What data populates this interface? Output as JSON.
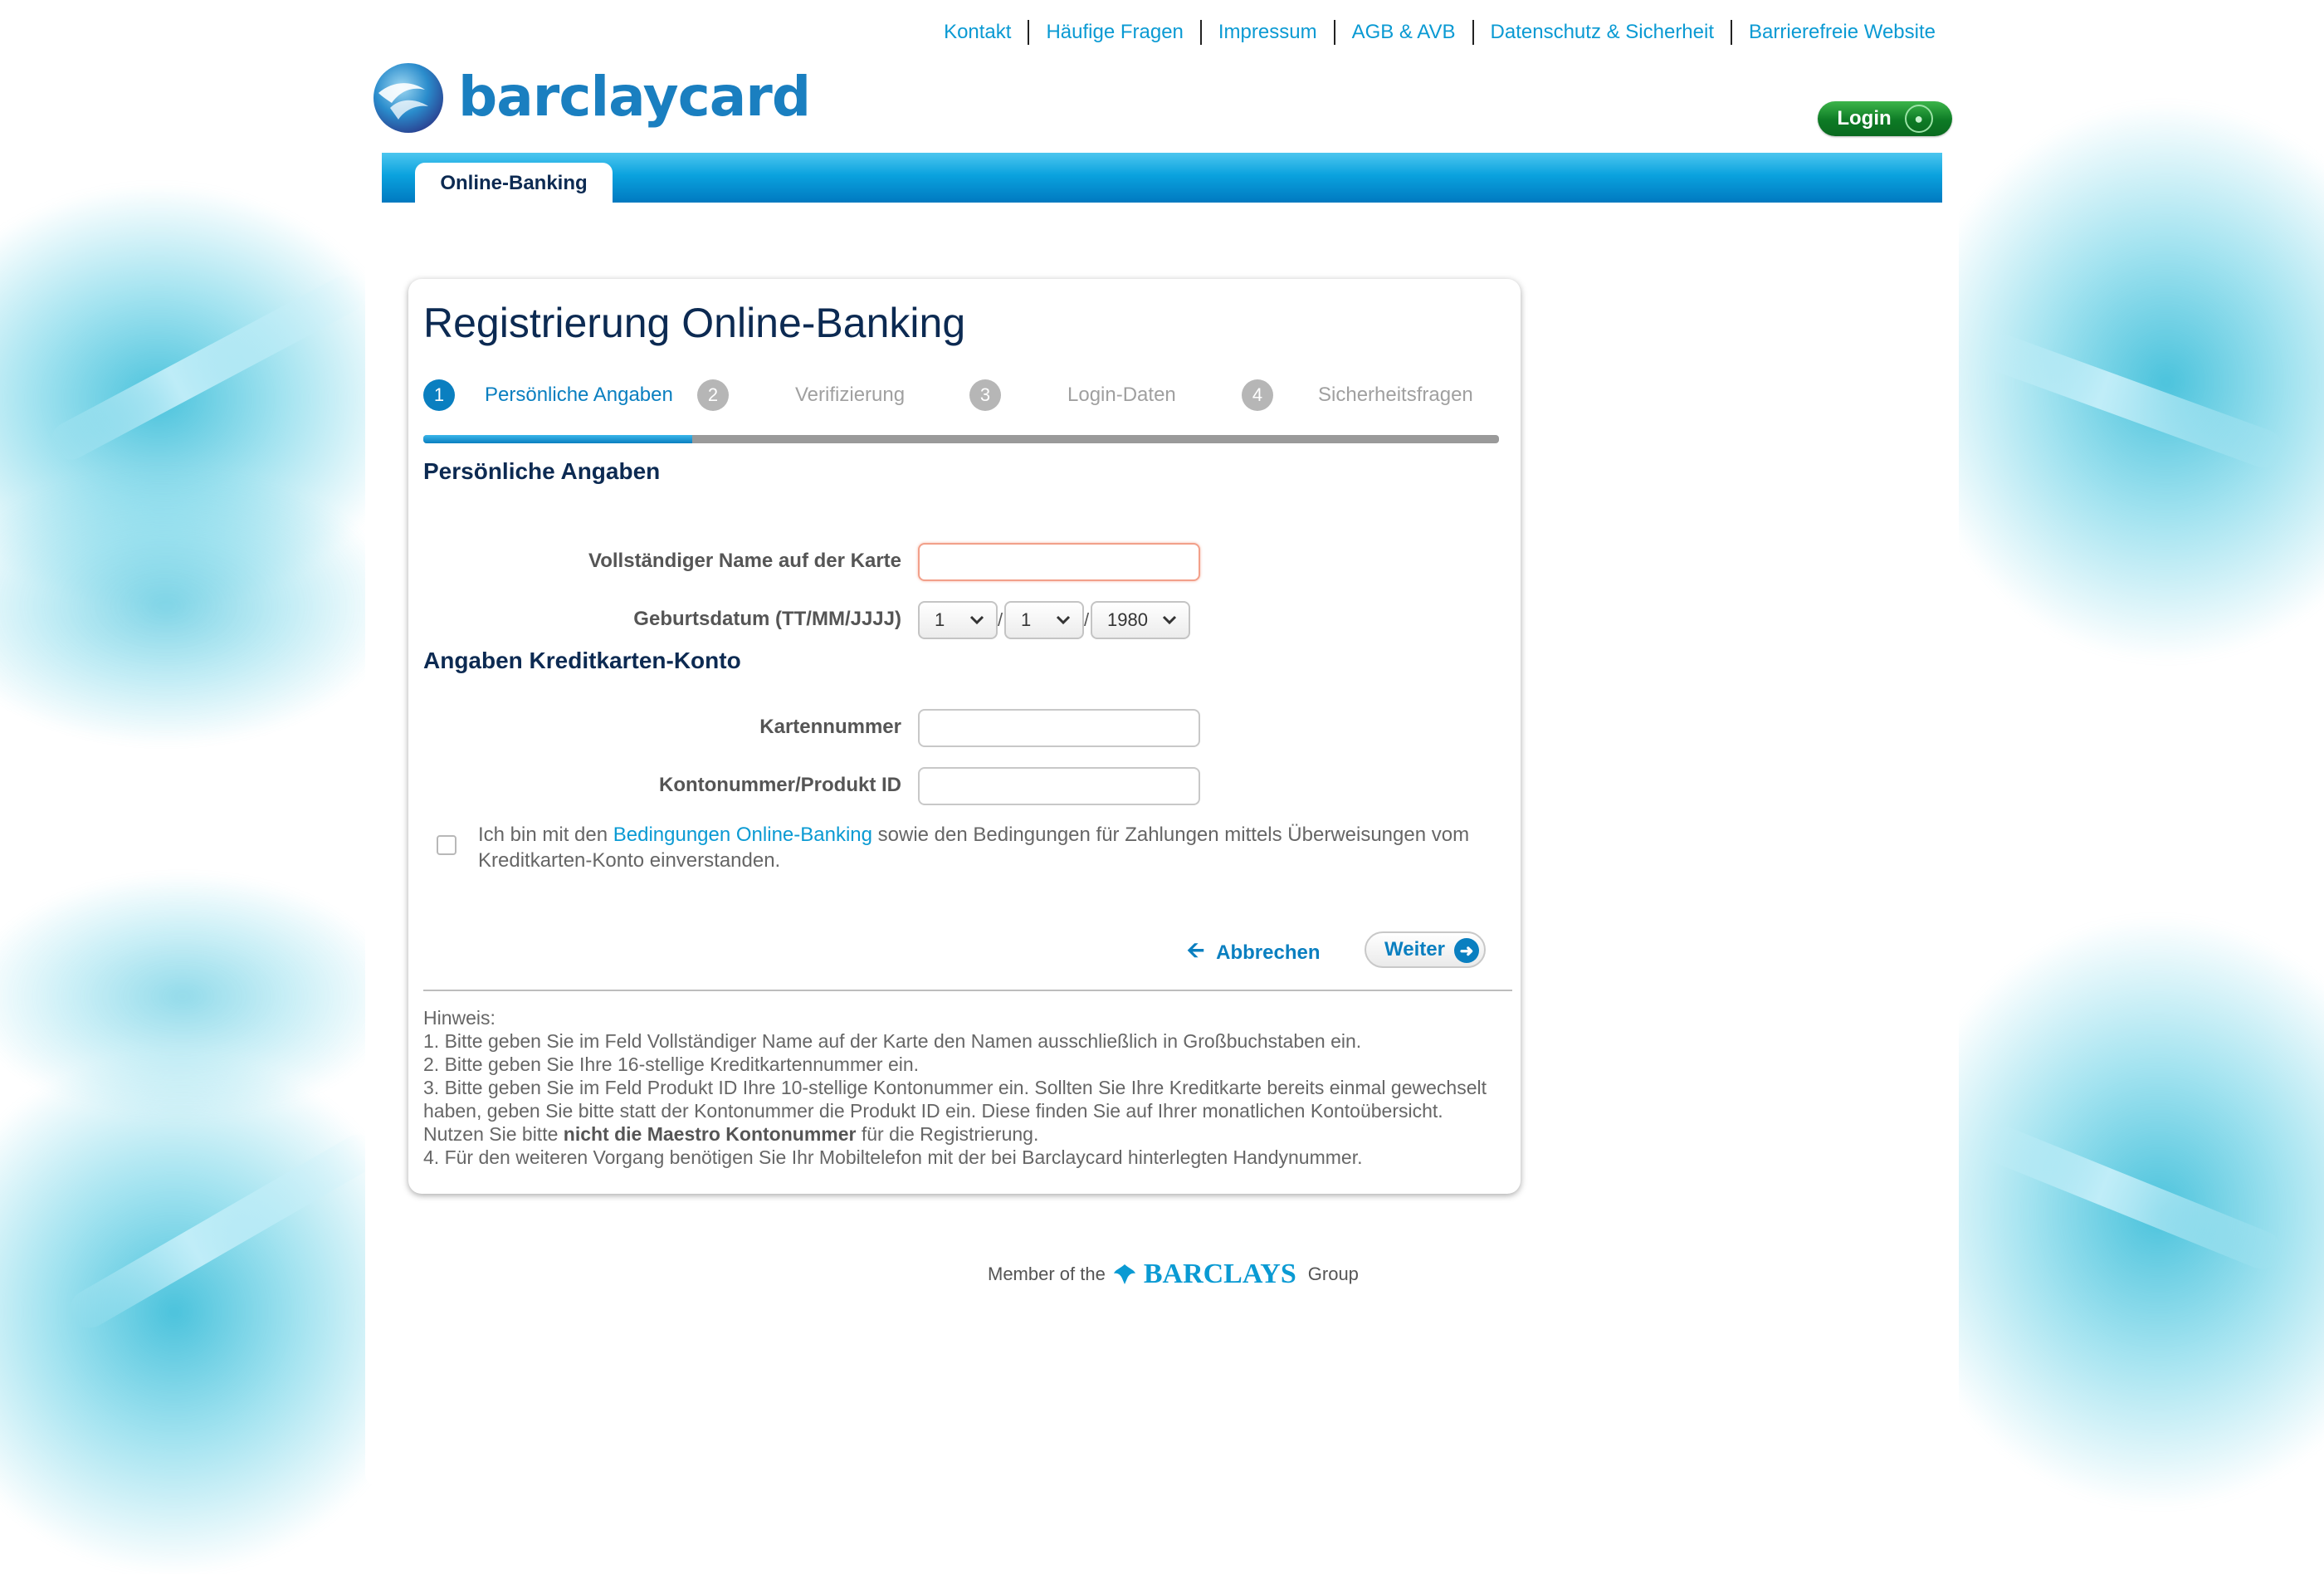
{
  "top_links": [
    "Kontakt",
    "Häufige Fragen",
    "Impressum",
    "AGB & AVB",
    "Datenschutz & Sicherheit",
    "Barrierefreie Website"
  ],
  "logo": {
    "text": "barclaycard"
  },
  "login": {
    "label": "Login",
    "icon": "lock-icon"
  },
  "nav": {
    "tab": "Online-Banking"
  },
  "card": {
    "title": "Registrierung Online-Banking",
    "steps": [
      {
        "num": "1",
        "label": "Persönliche Angaben",
        "state": "active"
      },
      {
        "num": "2",
        "label": "Verifizierung",
        "state": "inactive"
      },
      {
        "num": "3",
        "label": "Login-Daten",
        "state": "inactive"
      },
      {
        "num": "4",
        "label": "Sicherheitsfragen",
        "state": "inactive"
      }
    ],
    "progress": 0.25,
    "section_personal": "Persönliche Angaben",
    "name_label": "Vollständiger Name auf der Karte",
    "name_value": "",
    "dob_label": "Geburtsdatum (TT/MM/JJJJ)",
    "dob_day": "1",
    "dob_month": "1",
    "dob_year": "1980",
    "dob_sep": "/",
    "section_account": "Angaben Kreditkarten-Konto",
    "card_number_label": "Kartennummer",
    "card_number_value": "",
    "account_label": "Kontonummer/Produkt ID",
    "account_value": "",
    "terms_pre": "Ich bin mit den ",
    "terms_link": "Bedingungen Online-Banking",
    "terms_post": " sowie den Bedingungen für Zahlungen mittels Überweisungen vom Kreditkarten-Konto einverstanden.",
    "cancel": "Abbrechen",
    "next": "Weiter",
    "notes": {
      "heading": "Hinweis:",
      "line1": "1. Bitte geben Sie im Feld Vollständiger Name auf der Karte den Namen ausschließlich in Großbuchstaben ein.",
      "line2": "2. Bitte geben Sie Ihre 16-stellige Kreditkartennummer ein.",
      "line3_pre": "3. Bitte geben Sie im  Feld Produkt ID Ihre 10-stellige Kontonummer ein. Sollten Sie Ihre Kreditkarte bereits einmal gewechselt haben, geben Sie bitte statt der Kontonummer die Produkt ID ein. Diese finden Sie auf Ihrer monatlichen Kontoübersicht. Nutzen Sie bitte ",
      "line3_bold": "nicht die Maestro Kontonummer",
      "line3_post": " für die Registrierung.",
      "line4": "4. Für den weiteren Vorgang benötigen Sie Ihr Mobiltelefon mit der bei Barclaycard hinterlegten Handynummer."
    }
  },
  "footer": {
    "member": "Member of the",
    "brand": "BARCLAYS",
    "group": "Group"
  },
  "colors": {
    "accent": "#0a7fc0",
    "link": "#0a9ad3",
    "heading": "#0c2a52",
    "login_green": "#0d7a25"
  }
}
